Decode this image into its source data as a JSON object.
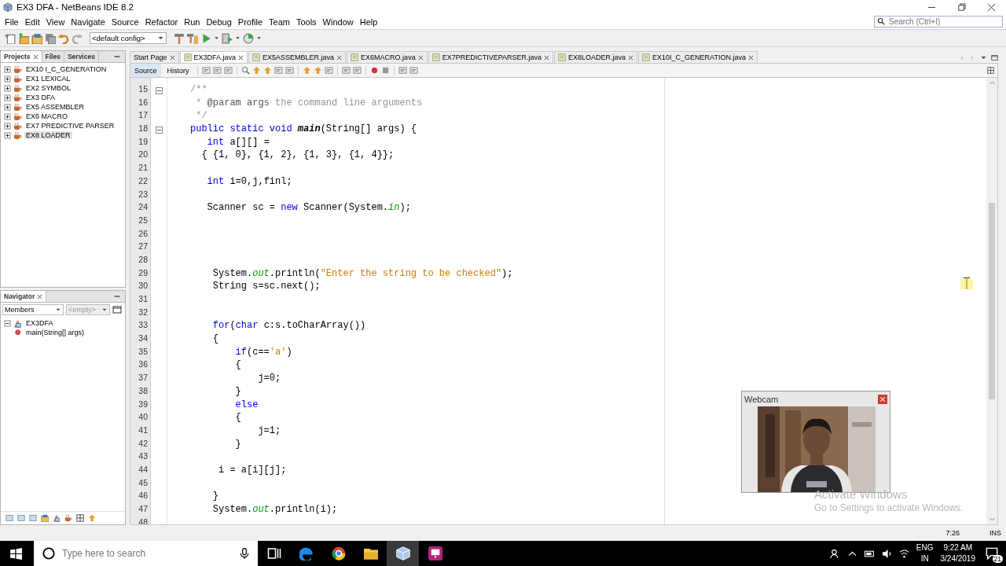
{
  "window": {
    "title": "EX3 DFA - NetBeans IDE 8.2"
  },
  "menu": [
    "File",
    "Edit",
    "View",
    "Navigate",
    "Source",
    "Refactor",
    "Run",
    "Debug",
    "Profile",
    "Team",
    "Tools",
    "Window",
    "Help"
  ],
  "search": {
    "placeholder": "Search (Ctrl+I)"
  },
  "toolbar": {
    "config": "<default config>"
  },
  "projects_panel": {
    "tabs": [
      {
        "label": "Projects",
        "selected": true
      },
      {
        "label": "Files",
        "selected": false
      },
      {
        "label": "Services",
        "selected": false
      }
    ],
    "items": [
      {
        "label": "EX10 I_C_GENERATION",
        "selected": false
      },
      {
        "label": "EX1 LEXICAL",
        "selected": false
      },
      {
        "label": "EX2 SYMBOL",
        "selected": false
      },
      {
        "label": "EX3 DFA",
        "selected": false
      },
      {
        "label": "EX5 ASSEMBLER",
        "selected": false
      },
      {
        "label": "EX6 MACRO",
        "selected": false
      },
      {
        "label": "EX7 PREDICTIVE PARSER",
        "selected": false
      },
      {
        "label": "EX8 LOADER",
        "selected": true
      }
    ]
  },
  "navigator": {
    "title": "Navigator",
    "filter": "Members",
    "scope_placeholder": "<empty>",
    "tree": [
      {
        "label": "EX3DFA",
        "kind": "class",
        "children": [
          {
            "label": "main(String[] args)",
            "kind": "method"
          }
        ]
      }
    ]
  },
  "editor": {
    "tabs": [
      {
        "label": "Start Page",
        "selected": false
      },
      {
        "label": "EX3DFA.java",
        "selected": true
      },
      {
        "label": "EX5ASSEMBLER.java",
        "selected": false
      },
      {
        "label": "EX6MACRO.java",
        "selected": false
      },
      {
        "label": "EX7PREDICTIVEPARSER.java",
        "selected": false
      },
      {
        "label": "EX8LOADER.java",
        "selected": false
      },
      {
        "label": "EX10I_C_GENERATION.java",
        "selected": false
      }
    ],
    "views": [
      {
        "label": "Source",
        "selected": true
      },
      {
        "label": "History",
        "selected": false
      }
    ],
    "lines": [
      {
        "number": "15",
        "fold": true,
        "tokens": [
          {
            "kind": "comment",
            "s": "/**"
          }
        ]
      },
      {
        "number": "16",
        "tokens": [
          {
            "kind": "comment",
            "s": " * "
          },
          {
            "kind": "tag",
            "s": "@param args"
          },
          {
            "kind": "comment",
            "s": " the command line arguments"
          }
        ]
      },
      {
        "number": "17",
        "tokens": [
          {
            "kind": "comment",
            "s": " */"
          }
        ]
      },
      {
        "number": "18",
        "fold": true,
        "tokens": [
          {
            "kind": "kw",
            "s": "public static void "
          },
          {
            "kind": "method",
            "s": "main"
          },
          {
            "kind": "plain",
            "s": "(String[] args) {"
          }
        ]
      },
      {
        "number": "19",
        "tokens": [
          {
            "kind": "kw",
            "s": "   int"
          },
          {
            "kind": "plain",
            "s": " a[][] ="
          }
        ]
      },
      {
        "number": "20",
        "tokens": [
          {
            "kind": "plain",
            "s": "  { {1, 0}, {1, 2}, {1, 3}, {1, 4}};"
          }
        ]
      },
      {
        "number": "21"
      },
      {
        "number": "22",
        "tokens": [
          {
            "kind": "kw",
            "s": "   int"
          },
          {
            "kind": "plain",
            "s": " i=0,j,finl;"
          }
        ]
      },
      {
        "number": "23"
      },
      {
        "number": "24",
        "tokens": [
          {
            "kind": "plain",
            "s": "   Scanner sc = "
          },
          {
            "kind": "kw",
            "s": "new"
          },
          {
            "kind": "plain",
            "s": " Scanner(System."
          },
          {
            "kind": "field",
            "s": "in"
          },
          {
            "kind": "plain",
            "s": ");"
          }
        ]
      },
      {
        "number": "25"
      },
      {
        "number": "26"
      },
      {
        "number": "27"
      },
      {
        "number": "28"
      },
      {
        "number": "29",
        "tokens": [
          {
            "kind": "plain",
            "s": "    System."
          },
          {
            "kind": "field",
            "s": "out"
          },
          {
            "kind": "plain",
            "s": ".println("
          },
          {
            "kind": "str",
            "s": "\"Enter the string to be checked\""
          },
          {
            "kind": "plain",
            "s": ");"
          }
        ]
      },
      {
        "number": "30",
        "tokens": [
          {
            "kind": "plain",
            "s": "    String s=sc.next();"
          }
        ]
      },
      {
        "number": "31"
      },
      {
        "number": "32"
      },
      {
        "number": "33",
        "tokens": [
          {
            "kind": "kw",
            "s": "    for"
          },
          {
            "kind": "plain",
            "s": "("
          },
          {
            "kind": "kw",
            "s": "char"
          },
          {
            "kind": "plain",
            "s": " c:s.toCharArray())"
          }
        ]
      },
      {
        "number": "34",
        "tokens": [
          {
            "kind": "plain",
            "s": "    {"
          }
        ]
      },
      {
        "number": "35",
        "tokens": [
          {
            "kind": "kw",
            "s": "        if"
          },
          {
            "kind": "plain",
            "s": "(c=="
          },
          {
            "kind": "str",
            "s": "'a'"
          },
          {
            "kind": "plain",
            "s": ")"
          }
        ]
      },
      {
        "number": "36",
        "tokens": [
          {
            "kind": "plain",
            "s": "        {"
          }
        ]
      },
      {
        "number": "37",
        "tokens": [
          {
            "kind": "plain",
            "s": "            j=0;"
          }
        ]
      },
      {
        "number": "38",
        "tokens": [
          {
            "kind": "plain",
            "s": "        }"
          }
        ]
      },
      {
        "number": "39",
        "tokens": [
          {
            "kind": "kw",
            "s": "        else"
          }
        ]
      },
      {
        "number": "40",
        "tokens": [
          {
            "kind": "plain",
            "s": "        {"
          }
        ]
      },
      {
        "number": "41",
        "tokens": [
          {
            "kind": "plain",
            "s": "            j=1;"
          }
        ]
      },
      {
        "number": "42",
        "tokens": [
          {
            "kind": "plain",
            "s": "        }"
          }
        ]
      },
      {
        "number": "43"
      },
      {
        "number": "44",
        "tokens": [
          {
            "kind": "plain",
            "s": "     i = a[i][j];"
          }
        ]
      },
      {
        "number": "45"
      },
      {
        "number": "46",
        "tokens": [
          {
            "kind": "plain",
            "s": "    }"
          }
        ]
      },
      {
        "number": "47",
        "tokens": [
          {
            "kind": "plain",
            "s": "    System."
          },
          {
            "kind": "field",
            "s": "out"
          },
          {
            "kind": "plain",
            "s": ".println(i);"
          }
        ]
      },
      {
        "number": "48"
      }
    ]
  },
  "webcam": {
    "title": "Webcam"
  },
  "activation_notice": {
    "title": "Activate Windows",
    "text": "Go to Settings to activate Windows."
  },
  "status_bar": {
    "position": "7:26",
    "mode": "INS"
  },
  "taskbar": {
    "search_placeholder": "Type here to search",
    "language": "ENG",
    "region": "IN",
    "time": "9:22 AM",
    "date": "3/24/2019",
    "notifications": "21"
  }
}
